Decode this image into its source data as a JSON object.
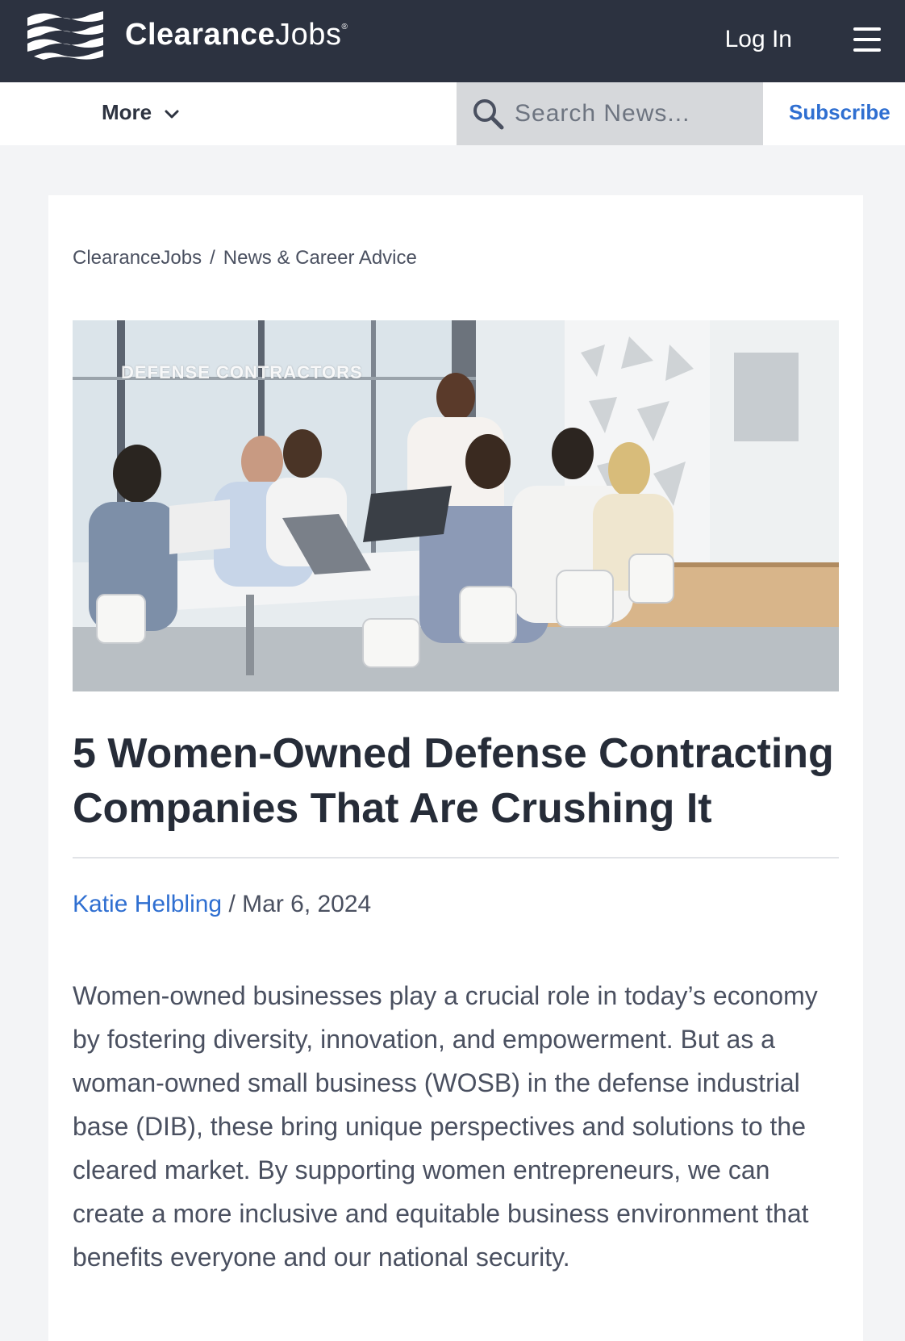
{
  "header": {
    "brand_bold": "Clearance",
    "brand_light": "Jobs",
    "brand_mark": "®",
    "login_label": "Log In",
    "menu_icon": "hamburger-icon"
  },
  "subnav": {
    "more_label": "More",
    "search_placeholder": "Search News...",
    "subscribe_label": "Subscribe"
  },
  "breadcrumb": {
    "items": [
      "ClearanceJobs",
      "News & Career Advice"
    ],
    "separator": "/"
  },
  "article": {
    "hero_tag": "DEFENSE CONTRACTORS",
    "title": "5 Women-Owned Defense Contracting Companies That Are Crushing It",
    "author": "Katie Helbling",
    "byline_sep": " / ",
    "date": "Mar 6, 2024",
    "lead": "Women-owned businesses play a crucial role in today’s economy by fostering diversity, innovation, and empowerment. But as a woman-owned small business (WOSB) in the defense industrial base (DIB), these bring unique perspectives and solutions to the cleared market. By supporting women entrepreneurs, we can create a more inclusive and equitable business environment that benefits everyone and our national security."
  },
  "colors": {
    "topbar": "#2c3240",
    "accent": "#2f6fd1",
    "page_bg": "#f3f4f6"
  }
}
